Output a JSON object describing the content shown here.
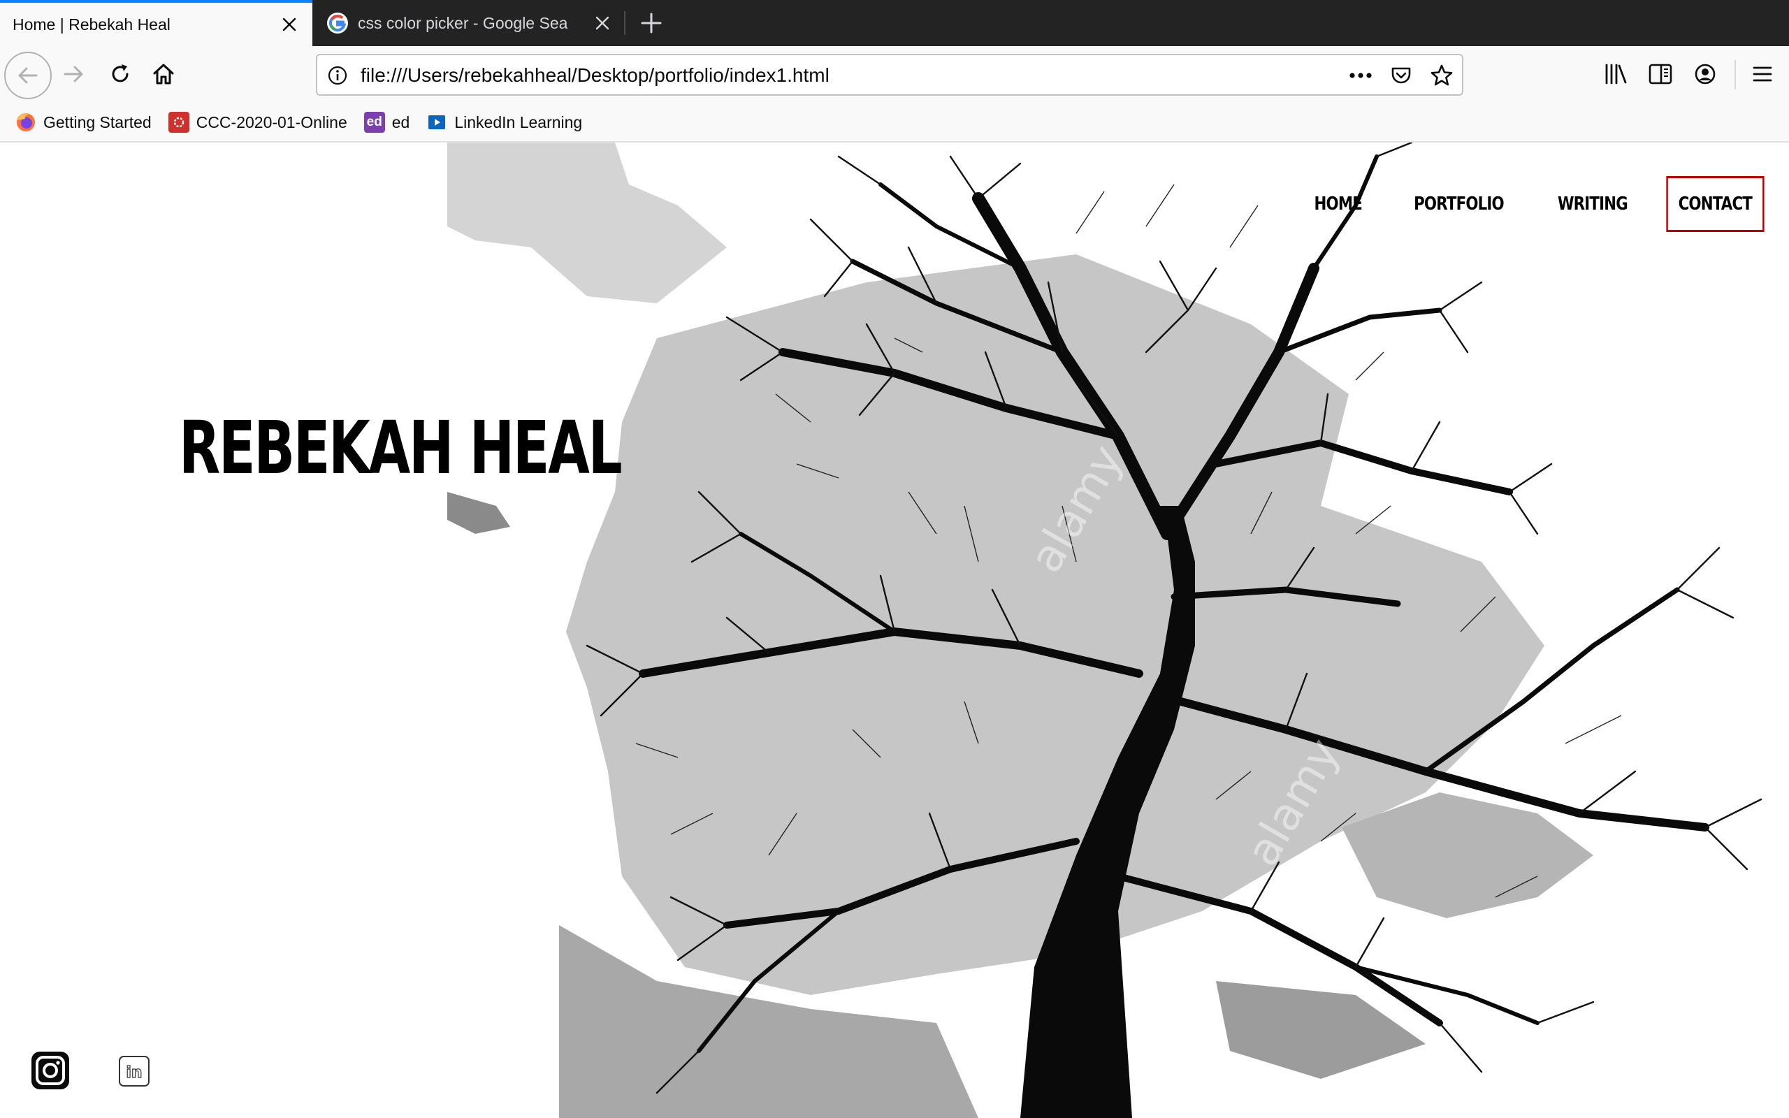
{
  "browser": {
    "tabs": [
      {
        "title": "Home | Rebekah Heal",
        "active": true
      },
      {
        "title": "css color picker - Google Search",
        "active": false,
        "favicon": "google-icon"
      }
    ],
    "url": "file:///Users/rebekahheal/Desktop/portfolio/index1.html",
    "bookmarks": [
      {
        "label": "Getting Started",
        "icon": "firefox-icon"
      },
      {
        "label": "CCC-2020-01-Online",
        "icon": "ccc-icon"
      },
      {
        "label": "ed",
        "icon": "ed-icon",
        "icon_text": "ed"
      },
      {
        "label": "LinkedIn Learning",
        "icon": "linkedin-learning-icon"
      }
    ],
    "accent_color": "#0a84ff"
  },
  "site": {
    "title": "REBEKAH HEAL",
    "nav": [
      "HOME",
      "PORTFOLIO",
      "WRITING",
      "CONTACT"
    ],
    "active_outline_color": "#c00000",
    "social": [
      "instagram-icon",
      "linkedin-icon"
    ],
    "watermark": "alamy",
    "linkedin_glyph": "in"
  }
}
